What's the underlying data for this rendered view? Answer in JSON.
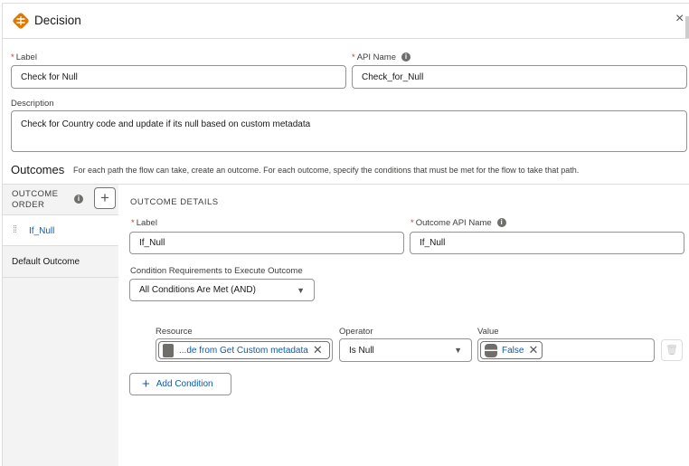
{
  "header": {
    "title": "Decision",
    "close": "×"
  },
  "label": {
    "label": "Label",
    "value": "Check for Null"
  },
  "api_name": {
    "label": "API Name",
    "value": "Check_for_Null"
  },
  "description": {
    "label": "Description",
    "value": "Check for Country code and update if its null based on custom metadata"
  },
  "outcomes": {
    "title": "Outcomes",
    "help": "For each path the flow can take, create an outcome. For each outcome, specify the conditions that must be met for the flow to take that path."
  },
  "order": {
    "header_line1": "OUTCOME",
    "header_line2": "ORDER",
    "add": "+",
    "items": [
      {
        "label": "If_Null"
      },
      {
        "label": "Default Outcome"
      }
    ]
  },
  "details": {
    "title": "OUTCOME DETAILS",
    "label": {
      "label": "Label",
      "value": "If_Null"
    },
    "api_name": {
      "label": "Outcome API Name",
      "value": "If_Null"
    },
    "condition_req": {
      "label": "Condition Requirements to Execute Outcome",
      "value": "All Conditions Are Met (AND)"
    },
    "condition": {
      "resource_label": "Resource",
      "resource_value": "...de from Get Custom metadata",
      "operator_label": "Operator",
      "operator_value": "Is Null",
      "value_label": "Value",
      "value_value": "False"
    },
    "add_condition": "Add Condition"
  }
}
